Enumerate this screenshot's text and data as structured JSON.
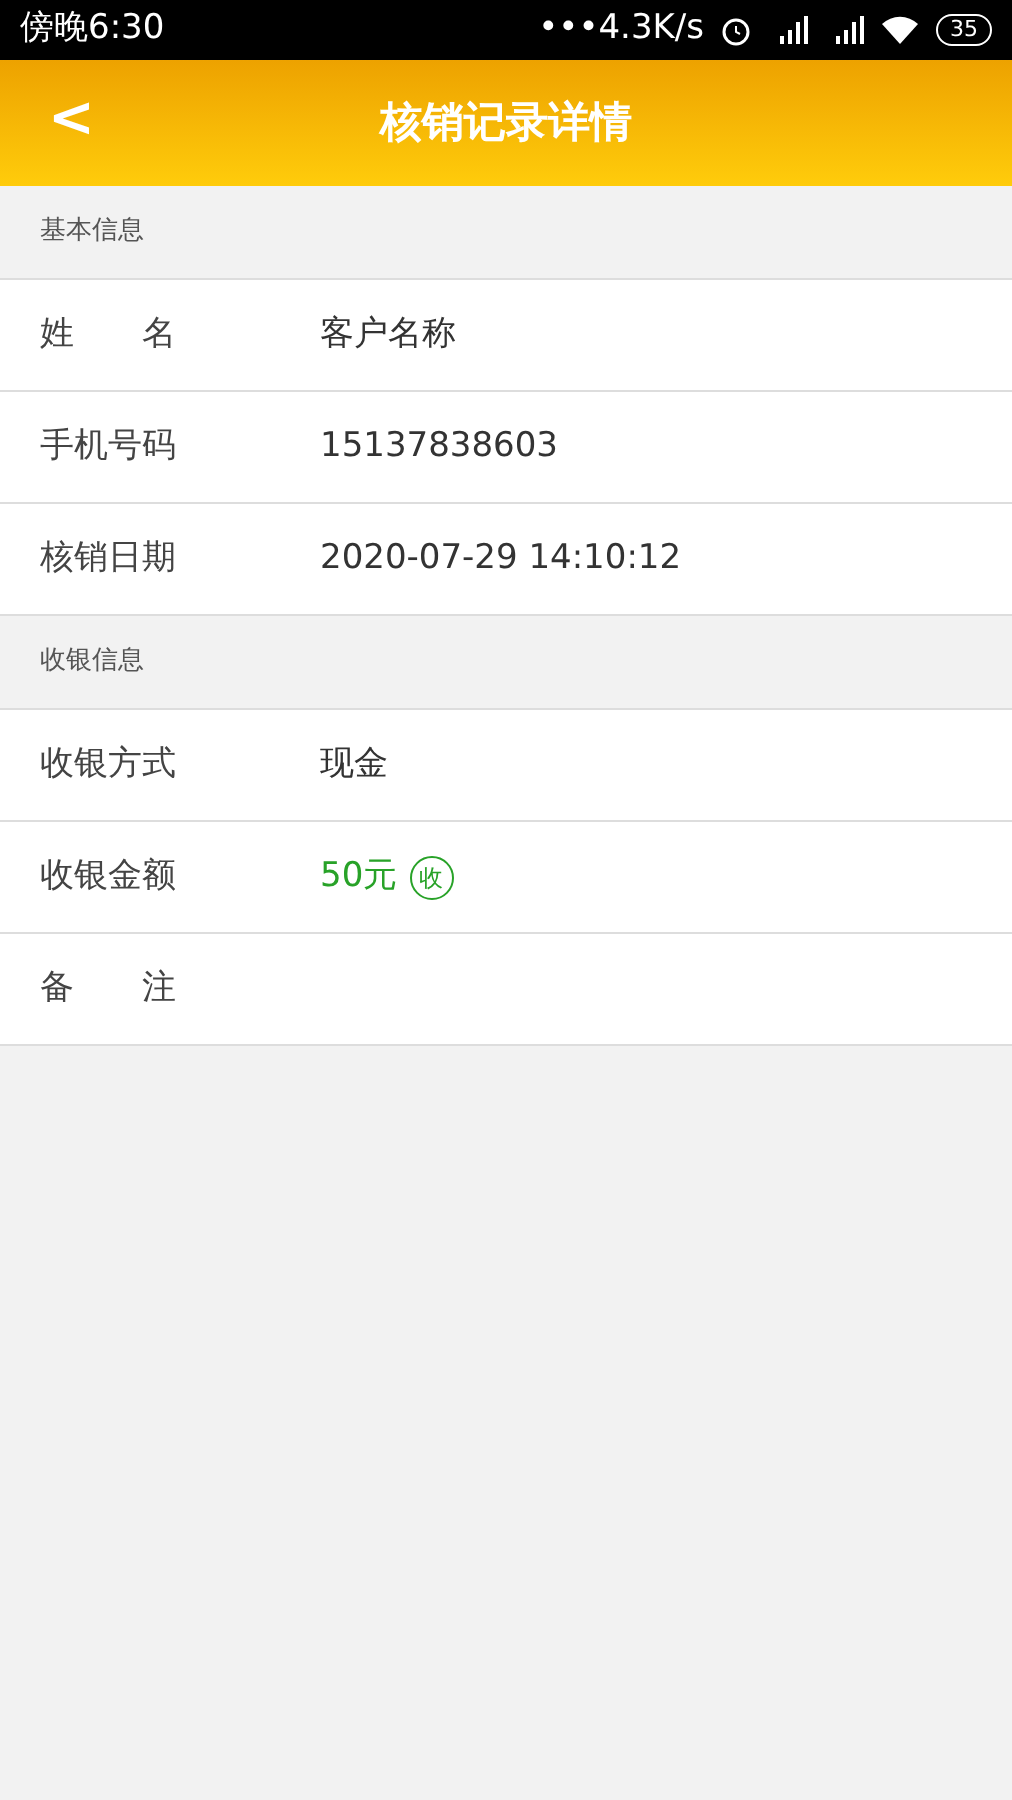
{
  "status_bar": {
    "time": "傍晚6:30",
    "speed": "•••4.3K/s",
    "battery": "35"
  },
  "header": {
    "back": "<",
    "title": "核销记录详情"
  },
  "sections": [
    {
      "title": "基本信息",
      "rows": [
        {
          "label": "姓　　名",
          "value": "客户名称",
          "kind": "plain"
        },
        {
          "label": "手机号码",
          "value": "15137838603",
          "kind": "plain"
        },
        {
          "label": "核销日期",
          "value": "2020-07-29 14:10:12",
          "kind": "plain"
        }
      ]
    },
    {
      "title": "收银信息",
      "rows": [
        {
          "label": "收银方式",
          "value": "现金",
          "kind": "plain"
        },
        {
          "label": "收银金额",
          "value": "50元",
          "kind": "amount",
          "badge": "收"
        },
        {
          "label": "备　　注",
          "value": "",
          "kind": "plain"
        }
      ]
    }
  ]
}
